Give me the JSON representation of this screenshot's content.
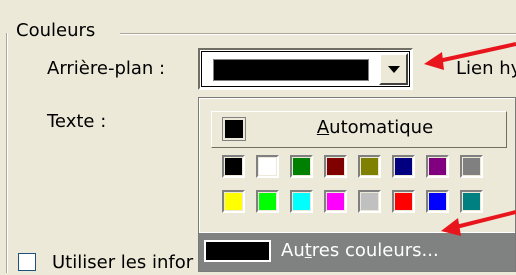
{
  "group": {
    "title": "Couleurs"
  },
  "background_row": {
    "label": "Arrière-plan :",
    "selected_color": "#000000",
    "dropdown_icon": "chevron-down-icon"
  },
  "text_row": {
    "label": "Texte :"
  },
  "right_text": "Lien hy",
  "checkbox_row": {
    "label": "Utiliser les infor",
    "checked": false
  },
  "dropdown": {
    "automatic_label": "Automatique",
    "automatic_color": "#000000",
    "more_colors_label": "Autres couleurs...",
    "more_colors_prefix": "Au",
    "more_colors_accel": "t",
    "more_colors_suffix": "res couleurs...",
    "more_colors_swatch": "#000000",
    "palette": [
      "#000000",
      "#ffffff",
      "#008000",
      "#800000",
      "#808000",
      "#000080",
      "#800080",
      "#808080",
      "#ffff00",
      "#00ff00",
      "#00ffff",
      "#ff00ff",
      "#c0c0c0",
      "#ff0000",
      "#0000ff",
      "#008080"
    ]
  },
  "annotation_color": "#e8161c"
}
